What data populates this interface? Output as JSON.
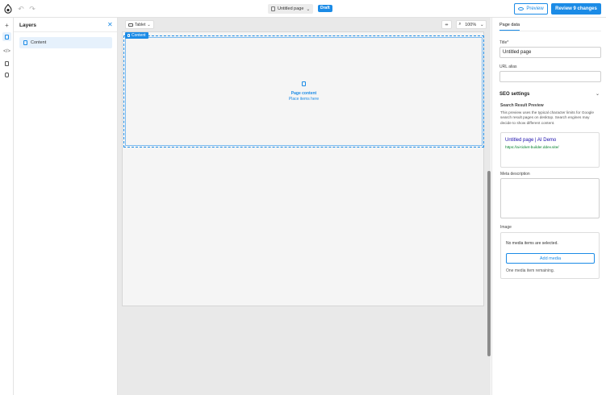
{
  "toolbar": {
    "page_name": "Untitled page",
    "status_badge": "Draft",
    "preview_label": "Preview",
    "review_label": "Review 9 changes"
  },
  "rail": {
    "icons": [
      "add-icon",
      "layers-icon",
      "code-icon",
      "page-icon",
      "database-icon"
    ]
  },
  "layers": {
    "title": "Layers",
    "items": [
      {
        "label": "Content"
      }
    ]
  },
  "canvas": {
    "device": "Tablet",
    "zoom": "100%",
    "content_tag": "Content",
    "placeholder_title": "Page content",
    "placeholder_hint": "Place items here"
  },
  "props": {
    "tab": "Page data",
    "title_label": "Title*",
    "title_value": "Untitled page",
    "url_alias_label": "URL alias",
    "url_alias_value": "",
    "seo": {
      "heading": "SEO settings",
      "preview_heading": "Search Result Preview",
      "preview_desc": "This preview uses the typical character limits for Google search result pages on desktop. Search engines may decide to show different content.",
      "serp_title": "Untitled page | AI Demo",
      "serp_url": "https://ai-ticket-builder.ddev.site/"
    },
    "meta_label": "Meta description",
    "meta_value": "",
    "image_label": "Image",
    "media": {
      "empty_text": "No media items are selected.",
      "add_label": "Add media",
      "remaining": "One media item remaining."
    }
  },
  "colors": {
    "accent": "#1b8be6",
    "serp_title": "#1a0dab",
    "serp_url": "#00802b"
  }
}
